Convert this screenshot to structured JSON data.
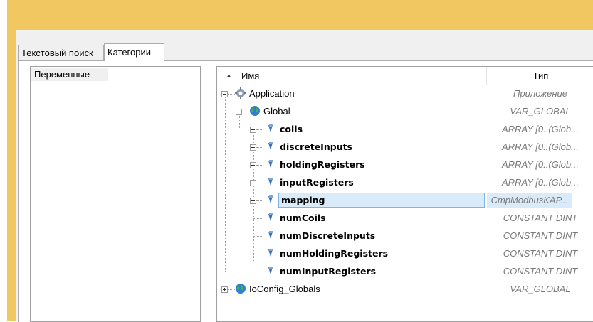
{
  "tabs": [
    {
      "label": "Текстовый поиск"
    },
    {
      "label": "Категории"
    }
  ],
  "categories": [
    {
      "label": "Переменные"
    }
  ],
  "tree": {
    "columns": {
      "name": "Имя",
      "type": "Тип"
    },
    "rows": [
      {
        "name": "Application",
        "type": "Приложение",
        "icon": "gear-icon"
      },
      {
        "name": "Global",
        "type": "VAR_GLOBAL",
        "icon": "globe-icon"
      },
      {
        "name": "coils",
        "type": "ARRAY [0..(Glob...",
        "icon": "variable-icon"
      },
      {
        "name": "discreteInputs",
        "type": "ARRAY [0..(Glob...",
        "icon": "variable-icon"
      },
      {
        "name": "holdingRegisters",
        "type": "ARRAY [0..(Glob...",
        "icon": "variable-icon"
      },
      {
        "name": "inputRegisters",
        "type": "ARRAY [0..(Glob...",
        "icon": "variable-icon"
      },
      {
        "name": "mapping",
        "type": "CmpModbusKAP...",
        "icon": "variable-icon",
        "selected": true
      },
      {
        "name": "numCoils",
        "type": "CONSTANT DINT",
        "icon": "variable-icon"
      },
      {
        "name": "numDiscreteInputs",
        "type": "CONSTANT DINT",
        "icon": "variable-icon"
      },
      {
        "name": "numHoldingRegisters",
        "type": "CONSTANT DINT",
        "icon": "variable-icon"
      },
      {
        "name": "numInputRegisters",
        "type": "CONSTANT DINT",
        "icon": "variable-icon"
      },
      {
        "name": "IoConfig_Globals",
        "type": "VAR_GLOBAL",
        "icon": "globe-icon"
      }
    ]
  },
  "colors": {
    "frame": "#f0c760",
    "selection": "#d9ebf9",
    "type_text": "#7a7a7a"
  }
}
